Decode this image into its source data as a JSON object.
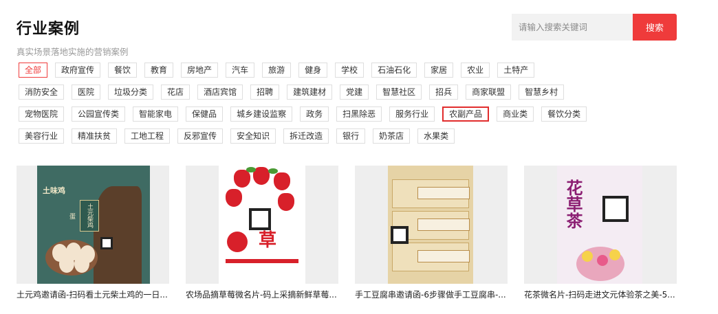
{
  "header": {
    "title": "行业案例",
    "subtitle": "真实场景落地实施的营销案例"
  },
  "search": {
    "placeholder": "请输入搜索关键词",
    "button_label": "搜索"
  },
  "tags": {
    "active": "全部",
    "highlighted": "农副产品",
    "rows": [
      [
        "全部",
        "政府宣传",
        "餐饮",
        "教育",
        "房地产",
        "汽车",
        "旅游",
        "健身",
        "学校",
        "石油石化",
        "家居",
        "农业",
        "土特产"
      ],
      [
        "消防安全",
        "医院",
        "垃圾分类",
        "花店",
        "酒店宾馆",
        "招聘",
        "建筑建材",
        "党建",
        "智慧社区",
        "招兵",
        "商家联盟",
        "智慧乡村"
      ],
      [
        "宠物医院",
        "公园宣传类",
        "智能家电",
        "保健品",
        "城乡建设监察",
        "政务",
        "扫黑除恶",
        "服务行业",
        "农副产品",
        "商业类",
        "餐饮分类"
      ],
      [
        "美容行业",
        "精准扶贫",
        "工地工程",
        "反邪宣传",
        "安全知识",
        "拆迁改造",
        "银行",
        "奶茶店",
        "水果类"
      ]
    ]
  },
  "cards": [
    {
      "title": "土元鸡邀请函-扫码看土元柴土鸡的一日...",
      "poster_brand": "土味鸡",
      "poster_label": "土元柴鸡蛋"
    },
    {
      "title": "农场品摘草莓微名片-码上采摘新鲜草莓...",
      "poster_text": "草"
    },
    {
      "title": "手工豆腐串邀请函-6步骤做手工豆腐串-..."
    },
    {
      "title": "花茶微名片-扫码走进文元体验茶之美-5...",
      "poster_text": "花草茶"
    }
  ],
  "colors": {
    "accent": "#ef3b3b",
    "highlight_border": "#e12c2c",
    "tag_border": "#dedede",
    "subtitle": "#9a9a9a"
  }
}
